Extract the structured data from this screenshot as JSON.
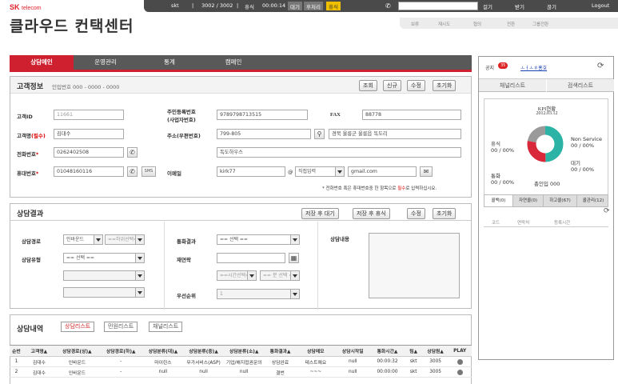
{
  "brand": {
    "sk": "SK",
    "telecom": "telecom",
    "title": "클라우드 컨택센터"
  },
  "topbar": {
    "user": "skt",
    "extension": "3002 / 3002",
    "status_label": "휴식",
    "timer": "00:00:14",
    "states": [
      "대기",
      "후처리",
      "휴식"
    ],
    "phone_value": "",
    "actions": [
      "걸기",
      "받기",
      "끊기"
    ],
    "logout": "Logout"
  },
  "subbar": {
    "items": [
      "보류",
      "재시도",
      "협의",
      "전환",
      "그룹전환"
    ]
  },
  "tabs": [
    "상담메인",
    "운영관리",
    "통계",
    "캠페인"
  ],
  "customer": {
    "title": "고객정보",
    "sub_label": "인입번호 000 - 0000 - 0000",
    "buttons": [
      "조회",
      "신규",
      "수정",
      "초기화"
    ],
    "fields": {
      "id_label": "고객ID",
      "id_value": "11661",
      "name_label": "고객명",
      "name_req": "(필수)",
      "name_value": "김대수",
      "phone_label": "전화번호",
      "phone_value": "0262402508",
      "mobile_label": "휴대번호",
      "mobile_value": "01048160116",
      "sms": "SMS",
      "rrn_label1": "주민등록번호",
      "rrn_label2": "(사업자번호)",
      "rrn_value": "9789798713515",
      "fax_label": "FAX",
      "fax_value": "88778",
      "addr_label": "주소(우편번호)",
      "zip_value": "799-805",
      "addr1_value": "경북 울릉군 울릉읍 독도리",
      "addr2_value": "독도하우스",
      "email_label": "이메일",
      "email_id": "kirk77",
      "email_at": "@",
      "email_select": "직접입력",
      "email_domain": "gmail.com"
    },
    "note_pre": "* 전화번호 혹은 휴대번호중 한 항목으로 ",
    "note_req": "필수",
    "note_post": "로 입력하십시요."
  },
  "result": {
    "title": "상담결과",
    "buttons": [
      "저장 후 대기",
      "저장 후 휴식",
      "수정",
      "초기화"
    ],
    "route_label": "상담경로",
    "route_value": "인바운드",
    "route_sub": "==하위선택==",
    "type_label": "상담유형",
    "type_value": "== 선택 ==",
    "call_label": "통화결과",
    "call_value": "== 선택 ==",
    "recall_label": "재연락",
    "recall_time": "==시간선택==",
    "recall_min": "== 분 선택 ==",
    "priority_label": "우선순위",
    "priority_value": "1",
    "content_label": "상담내용"
  },
  "history": {
    "title": "상담내역",
    "tabs": [
      "상담리스트",
      "민원리스트",
      "채널리스트"
    ],
    "columns": [
      "순번",
      "고객명▲",
      "상담경로(상)▲",
      "상담경로(하)▲",
      "상담분류(대)▲",
      "상담분류(중)▲",
      "상담분류(소)▲",
      "통화결과▲",
      "상담메모",
      "상담시작일",
      "통화시간▲",
      "팀▲",
      "상담원▲",
      "PLAY"
    ],
    "rows": [
      [
        "1",
        "김대수",
        "인바운드",
        "-",
        "마이린스",
        "무가서비스(ASP)",
        "기업/해지접권문의",
        "상담완료",
        "테스트예요",
        "null",
        "00:00:32",
        "skt",
        "3005",
        ""
      ],
      [
        "2",
        "김대수",
        "인바운드",
        "-",
        "null",
        "null",
        "null",
        "결번",
        "~~~",
        "null",
        "00:00:00",
        "skt",
        "3005",
        ""
      ]
    ]
  },
  "right": {
    "notice": "공지",
    "notice_count": "35",
    "notice_text": "ㅗㅓㅗㅎ홍호",
    "btn_channel": "채널리스트",
    "btn_search": "검색리스트",
    "kpi_title": "KPI현황",
    "kpi_date": "2012.03.12",
    "legend_rest": "휴식",
    "legend_rest_val": "00 / 00%",
    "legend_nonservice": "Non Service",
    "legend_nonservice_val": "00 / 00%",
    "legend_wait": "대기",
    "legend_wait_val": "00 / 00%",
    "legend_talk": "통화",
    "legend_talk_val": "00 / 00%",
    "total_in": "총인입 000",
    "tabs": [
      "콜백(0)",
      "자연콜(0)",
      "하고콜(67)",
      "콜관리(12)"
    ],
    "cols": [
      "코드",
      "연락처",
      "등록시간"
    ]
  }
}
